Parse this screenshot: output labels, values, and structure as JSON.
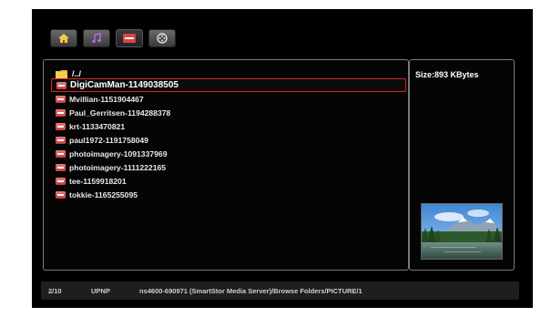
{
  "tabs": [
    {
      "name": "home",
      "icon": "home-icon"
    },
    {
      "name": "music",
      "icon": "music-note-icon"
    },
    {
      "name": "pictures",
      "icon": "picture-icon",
      "active": true
    },
    {
      "name": "video",
      "icon": "film-reel-icon"
    }
  ],
  "file_list": {
    "parent_folder": "/../",
    "items": [
      {
        "label": "DigiCamMan-1149038505",
        "selected": true
      },
      {
        "label": "Mvillian-1151904467"
      },
      {
        "label": "Paul_Gerritsen-1194288378"
      },
      {
        "label": "krt-1133470821"
      },
      {
        "label": "paul1972-1191758049"
      },
      {
        "label": "photoimagery-1091337969"
      },
      {
        "label": "photoimagery-1111222165"
      },
      {
        "label": "tee-1159918201"
      },
      {
        "label": "tokkie-1165255095"
      }
    ]
  },
  "info": {
    "size": "Size:893 KBytes"
  },
  "status": {
    "count": "2/10",
    "protocol": "UPNP",
    "path": "ns4600-690971 (SmartStor Media Server)/Browse Folders/PICTURE/1"
  },
  "colors": {
    "selection_border": "#d32a1c",
    "panel_border": "#7a7a7a",
    "background": "#000000"
  }
}
